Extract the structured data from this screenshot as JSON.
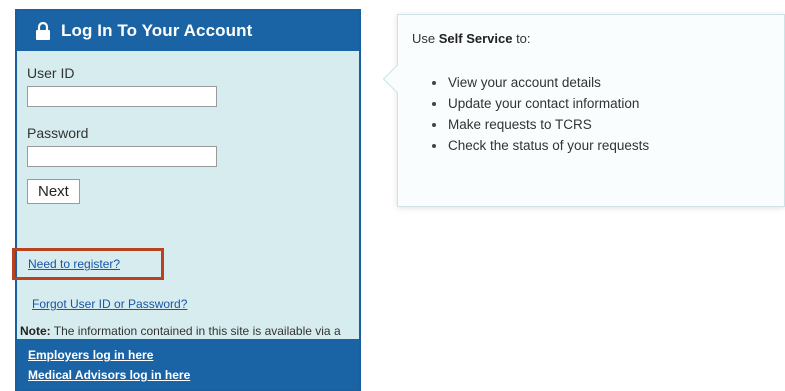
{
  "login": {
    "title": "Log In To Your Account",
    "lock_icon": "lock-icon",
    "user_id_label": "User ID",
    "user_id_value": "",
    "password_label": "Password",
    "password_value": "",
    "next_label": "Next",
    "register_link": "Need to register?",
    "forgot_link": "Forgot User ID or Password?",
    "note_label": "Note:",
    "note_text": " The information contained in this site is available via a secure connection.",
    "employers_link": "Employers log in here",
    "medical_link": "Medical Advisors log in here"
  },
  "info": {
    "intro_prefix": "Use ",
    "intro_bold": "Self Service",
    "intro_suffix": " to:",
    "items": [
      "View your account details",
      "Update your contact information",
      "Make requests to TCRS",
      "Check the status of your requests"
    ]
  },
  "colors": {
    "header_blue": "#1a63a4",
    "panel_bg": "#d6ecef",
    "highlight_border": "#b8431e",
    "link_blue": "#1a55a8"
  }
}
